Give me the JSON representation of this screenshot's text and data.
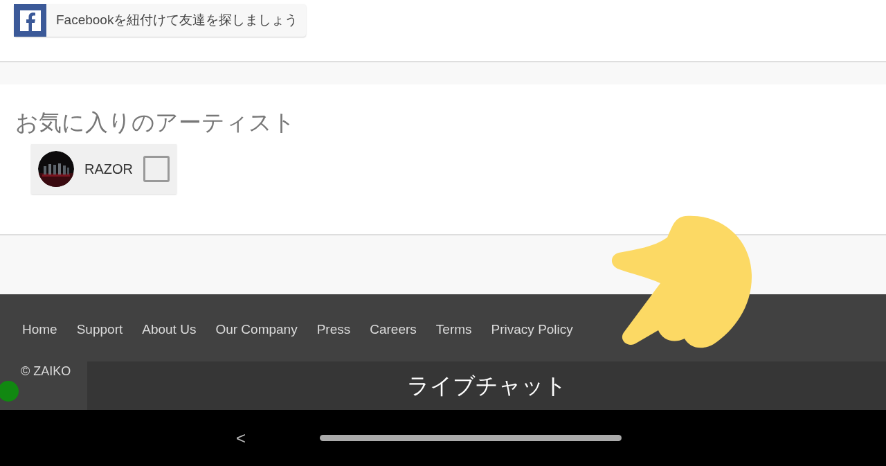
{
  "facebook_button": {
    "label": "Facebookを紐付けて友達を探しましょう"
  },
  "favorites": {
    "heading": "お気に入りのアーティスト",
    "artists": [
      {
        "name": "RAZOR",
        "checked": false
      }
    ]
  },
  "footer": {
    "links": [
      "Home",
      "Support",
      "About Us",
      "Our Company",
      "Press",
      "Careers",
      "Terms",
      "Privacy Policy"
    ],
    "copyright": "© ZAIKO"
  },
  "chat_bar": {
    "label": "ライブチャット"
  },
  "nav_bar": {
    "back": "<"
  }
}
